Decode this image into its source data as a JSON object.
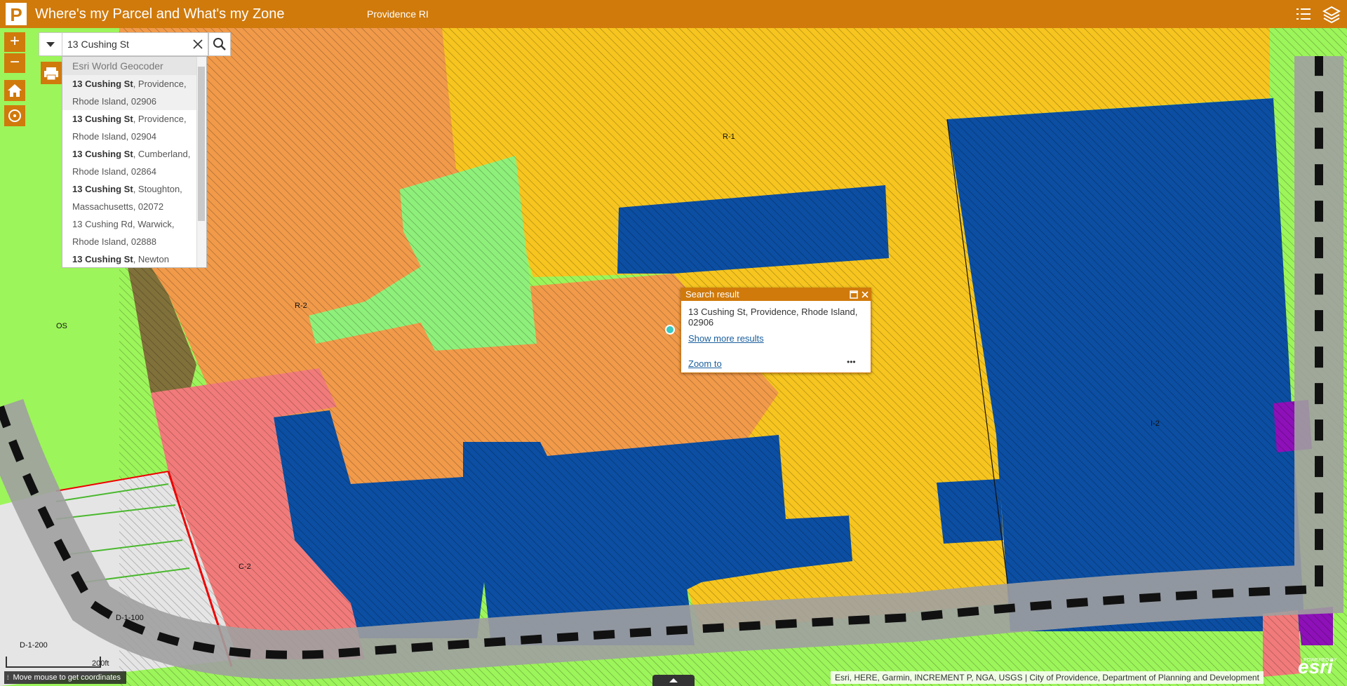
{
  "header": {
    "title": "Where's my Parcel and What's my Zone",
    "subtitle": "Providence RI",
    "logo_letter": "P",
    "background": "#d07a0c"
  },
  "search": {
    "value": "13 Cushing St",
    "source_label": "Esri World Geocoder",
    "suggestions": [
      {
        "bold": "13 Cushing St",
        "rest": ", Providence,",
        "line2": "Rhode Island, 02906"
      },
      {
        "bold": "13 Cushing St",
        "rest": ", Providence,",
        "line2": "Rhode Island, 02904"
      },
      {
        "bold": "13 Cushing St",
        "rest": ", Cumberland,",
        "line2": "Rhode Island, 02864"
      },
      {
        "bold": "13 Cushing St",
        "rest": ", Stoughton,",
        "line2": "Massachusetts, 02072"
      },
      {
        "bold": "",
        "rest": "13 Cushing Rd, Warwick,",
        "line2": "Rhode Island, 02888"
      },
      {
        "bold": "13 Cushing St",
        "rest": ", Newton",
        "line2": ""
      }
    ]
  },
  "map": {
    "zone_labels": [
      "R-1",
      "R-2",
      "OS",
      "C-2",
      "D-1-100",
      "D-1-200",
      "I-2"
    ],
    "colors": {
      "residential_1": "#f7c51f",
      "residential_2": "#f19a4a",
      "industrial": "#0b4ea2",
      "open_space": "#9cf55a",
      "commercial": "#f17b7a",
      "downtown": "#e5e5e5",
      "park_green": "#8ef07a",
      "brown": "#80703a",
      "purple": "#8e10b8"
    }
  },
  "popup": {
    "title": "Search result",
    "address_line1": "13 Cushing St, Providence, Rhode Island,",
    "address_line2": "02906",
    "show_more": "Show more results",
    "zoom_to": "Zoom to",
    "more": "•••"
  },
  "footer": {
    "coordinates_hint": "Move mouse to get coordinates",
    "attribution": "Esri, HERE, Garmin, INCREMENT P, NGA, USGS | City of Providence, Department of Planning and Development",
    "scale_label": "200ft",
    "esri_logo": "esri",
    "powered_by": "POWERED BY"
  }
}
